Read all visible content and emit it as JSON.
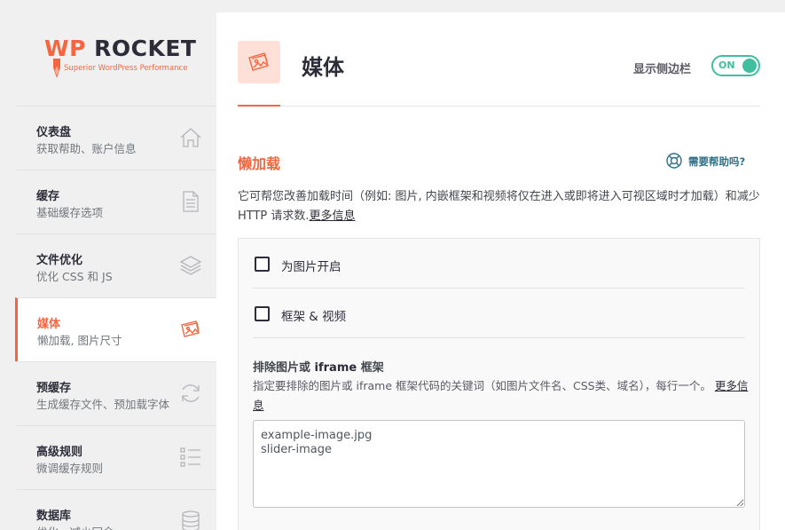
{
  "brand": {
    "wp": "WP",
    "rocket": "ROCKET",
    "tagline": "Superior WordPress Performance",
    "accent_color": "#f56640"
  },
  "sidebar": {
    "items": [
      {
        "title": "仪表盘",
        "desc": "获取帮助、账户信息",
        "icon": "home-icon",
        "active": false
      },
      {
        "title": "缓存",
        "desc": "基础缓存选项",
        "icon": "document-icon",
        "active": false
      },
      {
        "title": "文件优化",
        "desc": "优化 CSS 和 JS",
        "icon": "layers-icon",
        "active": false
      },
      {
        "title": "媒体",
        "desc": "懒加载, 图片尺寸",
        "icon": "images-icon",
        "active": true
      },
      {
        "title": "预缓存",
        "desc": "生成缓存文件、预加载字体",
        "icon": "refresh-icon",
        "active": false
      },
      {
        "title": "高级规则",
        "desc": "微调缓存规则",
        "icon": "list-icon",
        "active": false
      },
      {
        "title": "数据库",
        "desc": "优化、减少冗余",
        "icon": "database-icon",
        "active": false
      }
    ]
  },
  "header": {
    "title": "媒体",
    "icon": "images-icon",
    "sidebar_toggle_label": "显示侧边栏",
    "toggle_state": "ON",
    "toggle_color": "#40bf9e"
  },
  "lazyload": {
    "title": "懒加载",
    "help_label": "需要帮助吗?",
    "help_icon": "lifebuoy-icon",
    "description": "它可帮您改善加载时间（例如: 图片, 内嵌框架和视频将仅在进入或即将进入可视区域时才加载）和减少 HTTP 请求数.",
    "more_info": "更多信息",
    "options": [
      {
        "label": "为图片开启",
        "checked": false
      },
      {
        "label": "框架 & 视频",
        "checked": false
      }
    ],
    "exclude": {
      "title_prefix": "排除图片或 ",
      "title_bold": "iframe",
      "title_suffix": " 框架",
      "description": "指定要排除的图片或 iframe 框架代码的关键词（如图片文件名、CSS类、域名），每行一个。",
      "more_info": "更多信息",
      "value": "example-image.jpg\nslider-image"
    }
  }
}
